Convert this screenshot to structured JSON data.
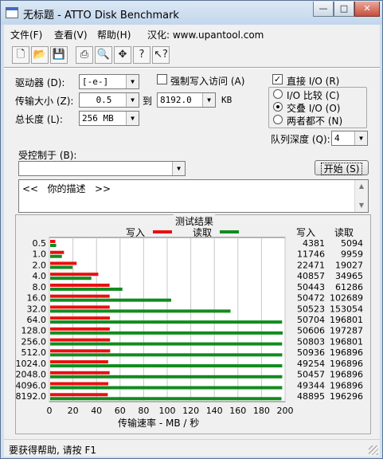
{
  "window": {
    "title": "无标题 - ATTO Disk Benchmark"
  },
  "menu": {
    "file": "文件(F)",
    "view": "查看(V)",
    "help": "帮助(H)",
    "site": "汉化: www.upantool.com"
  },
  "toolbar": {
    "icons": [
      "new-file-icon",
      "open-folder-icon",
      "save-icon",
      "print-icon",
      "print-preview-icon",
      "move-icon",
      "help-icon",
      "context-help-icon"
    ]
  },
  "controls": {
    "drive_label": "驱动器 (D):",
    "drive_value": "[-e-]",
    "transfer_label": "传输大小 (Z):",
    "transfer_from": "0.5",
    "transfer_to_label": "到",
    "transfer_to": "8192.0",
    "transfer_unit": "KB",
    "length_label": "总长度 (L):",
    "length_value": "256 MB",
    "force_write_label": "强制写入访问 (A)",
    "direct_io_label": "直接 I/O (R)",
    "io_compare_label": "I/O 比较 (C)",
    "overlap_io_label": "交叠 I/O (O)",
    "neither_label": "两者都不 (N)",
    "queue_label": "队列深度 (Q):",
    "queue_value": "4",
    "controlled_by_label": "受控制于 (B):",
    "controlled_by_value": "",
    "start_label": "开始 (S)",
    "description_text": "<<   你的描述   >>"
  },
  "chart_data": {
    "type": "bar",
    "title": "测试结果",
    "legend": {
      "write": "写入",
      "read": "读取",
      "placement": "top"
    },
    "categories": [
      "0.5",
      "1.0",
      "2.0",
      "4.0",
      "8.0",
      "16.0",
      "32.0",
      "64.0",
      "128.0",
      "256.0",
      "512.0",
      "1024.0",
      "2048.0",
      "4096.0",
      "8192.0"
    ],
    "series": [
      {
        "name": "写入",
        "color": "#e81010",
        "values": [
          4381,
          11746,
          22471,
          40857,
          50443,
          50472,
          50523,
          50704,
          50606,
          50803,
          50936,
          49254,
          50457,
          49344,
          48895
        ]
      },
      {
        "name": "读取",
        "color": "#118c1f",
        "values": [
          5094,
          9959,
          19027,
          34965,
          61286,
          102689,
          153054,
          196801,
          197287,
          196801,
          196896,
          196896,
          196896,
          196896,
          196296
        ]
      }
    ],
    "xlabel": "传输速率 - MB / 秒",
    "xticks": [
      "0",
      "20",
      "40",
      "60",
      "80",
      "100",
      "120",
      "140",
      "160",
      "180",
      "200"
    ],
    "xlim": [
      0,
      200
    ],
    "table_headers": {
      "write": "写入",
      "read": "读取"
    },
    "grid": true
  },
  "status": {
    "text": "要获得帮助, 请按 F1"
  }
}
